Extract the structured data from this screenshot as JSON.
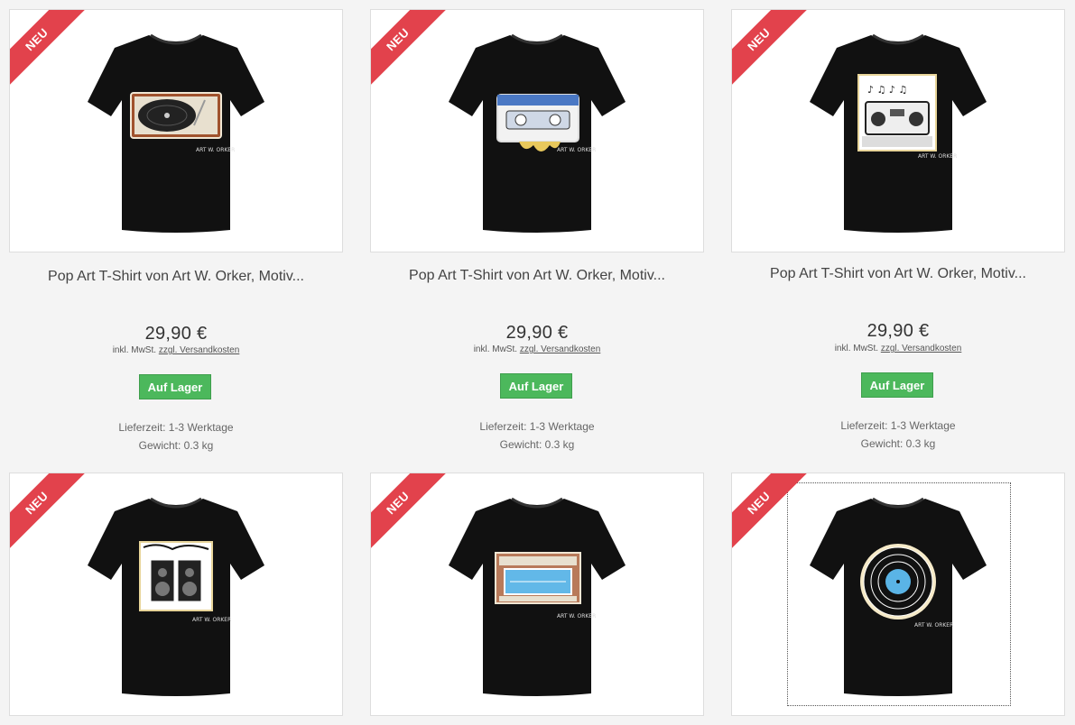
{
  "products": [
    {
      "badge": "NEU",
      "title": "Pop Art T-Shirt von Art W. Orker, Motiv...",
      "price": "29,90 €",
      "tax_prefix": "inkl. MwSt.",
      "shipping_link": "zzgl. Versandkosten",
      "stock_label": "Auf Lager",
      "delivery": "Lieferzeit: 1-3 Werktage",
      "weight": "Gewicht: 0.3 kg",
      "motif": "turntable-icon",
      "signature": "ART W. ORKER"
    },
    {
      "badge": "NEU",
      "title": "Pop Art T-Shirt von Art W. Orker, Motiv...",
      "price": "29,90 €",
      "tax_prefix": "inkl. MwSt.",
      "shipping_link": "zzgl. Versandkosten",
      "stock_label": "Auf Lager",
      "delivery": "Lieferzeit: 1-3 Werktage",
      "weight": "Gewicht: 0.3 kg",
      "motif": "cassette-icon",
      "signature": "ART W. ORKER"
    },
    {
      "badge": "NEU",
      "title": "Pop Art T-Shirt von Art W. Orker, Motiv...",
      "price": "29,90 €",
      "tax_prefix": "inkl. MwSt.",
      "shipping_link": "zzgl. Versandkosten",
      "stock_label": "Auf Lager",
      "delivery": "Lieferzeit: 1-3 Werktage",
      "weight": "Gewicht: 0.3 kg",
      "motif": "boombox-icon",
      "signature": "ART W. ORKER"
    },
    {
      "badge": "NEU",
      "motif": "speakers-icon",
      "signature": "ART W. ORKER"
    },
    {
      "badge": "NEU",
      "motif": "stereo-icon",
      "signature": "ART W. ORKER"
    },
    {
      "badge": "NEU",
      "motif": "vinyl-record-icon",
      "signature": "ART W. ORKER"
    }
  ],
  "colors": {
    "badge": "#e2424c",
    "stock": "#4cb85c",
    "shirt": "#111111"
  }
}
